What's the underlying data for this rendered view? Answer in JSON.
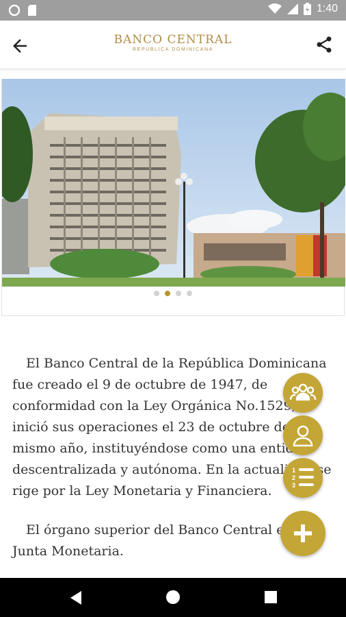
{
  "status_bar": {
    "time": "1:40"
  },
  "header": {
    "title": "BANCO CENTRAL",
    "subtitle": "REPÚBLICA DOMINICANA"
  },
  "carousel": {
    "slide_count": 4,
    "active_index": 1
  },
  "content": {
    "paragraph_1": "El Banco Central de la República Dominicana fue creado el 9 de octubre de 1947, de conformidad con la Ley Orgánica No.1529, e inició sus operaciones el 23 de octubre del mismo año, instituyéndose como una entidad descentralizada y autónoma. En la actualidad se rige por la Ley Monetaria y Financiera.",
    "paragraph_2": "El órgano superior del Banco Central es la Junta Monetaria."
  },
  "fab_menu": {
    "items": [
      "group-icon",
      "person-icon",
      "numbered-list-icon"
    ],
    "main": "plus-icon"
  },
  "colors": {
    "accent": "#c4a637",
    "logo": "#b08d45",
    "status_bar": "#9e9e9e"
  }
}
